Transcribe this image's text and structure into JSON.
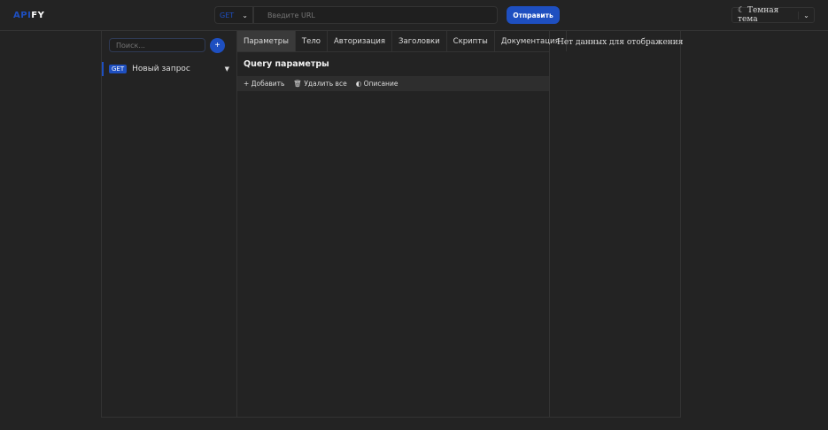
{
  "header": {
    "logo_part1": "API",
    "logo_part2": "FY",
    "method": "GET",
    "url_placeholder": "Введите URL",
    "send_label": "Отправить",
    "theme_label": "Темная тема"
  },
  "sidebar": {
    "search_placeholder": "Поиск...",
    "add_label": "+",
    "requests": [
      {
        "method": "GET",
        "name": "Новый запрос"
      }
    ]
  },
  "main": {
    "tabs": [
      "Параметры",
      "Тело",
      "Авторизация",
      "Заголовки",
      "Скрипты",
      "Документация"
    ],
    "section_title": "Query параметры",
    "toolbar": {
      "add": "+ Добавить",
      "delete_all": "Удалить все",
      "description": "Описание"
    }
  },
  "response": {
    "empty_text": "Нет данных для отображения"
  }
}
